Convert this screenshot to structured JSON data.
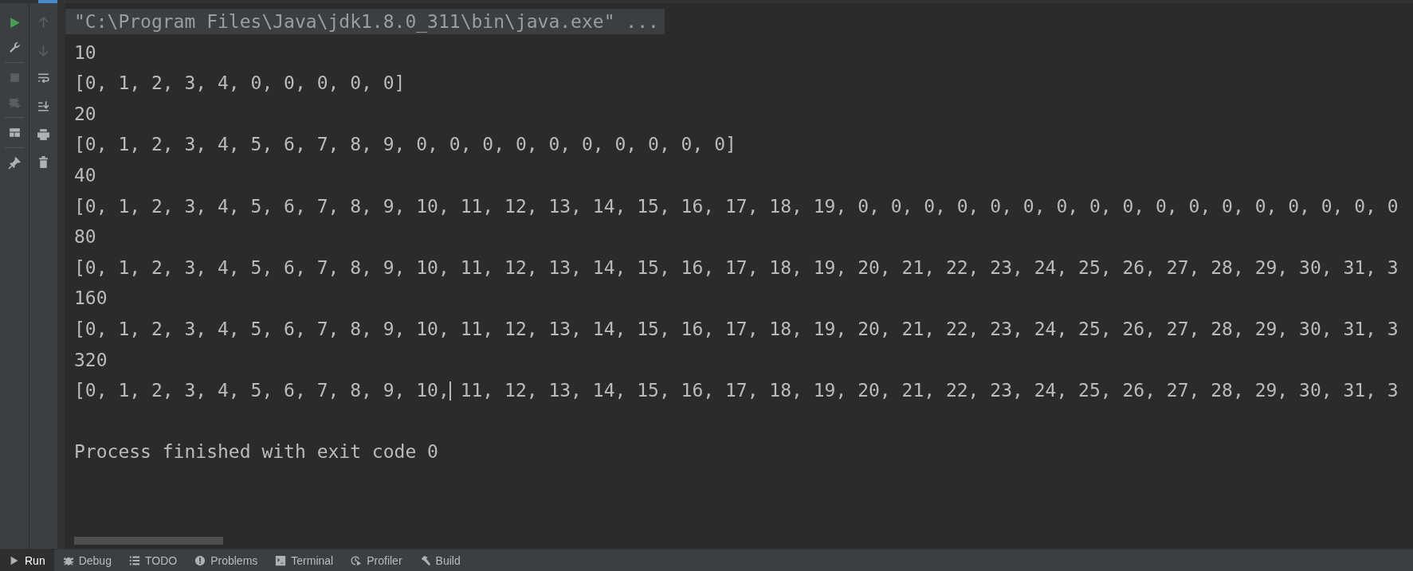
{
  "left_toolbar": [
    {
      "kind": "run",
      "disabled": false
    },
    {
      "kind": "wrench",
      "disabled": false
    },
    {
      "kind": "separator"
    },
    {
      "kind": "stop",
      "disabled": true
    },
    {
      "kind": "debug",
      "disabled": true
    },
    {
      "kind": "separator"
    },
    {
      "kind": "layout",
      "disabled": false
    },
    {
      "kind": "separator"
    },
    {
      "kind": "pin",
      "disabled": false
    }
  ],
  "console_toolbar": [
    {
      "kind": "up",
      "disabled": true
    },
    {
      "kind": "down",
      "disabled": true
    },
    {
      "kind": "wrap",
      "disabled": false
    },
    {
      "kind": "scrollend",
      "disabled": false
    },
    {
      "kind": "print",
      "disabled": false
    },
    {
      "kind": "trash",
      "disabled": false
    }
  ],
  "console_lines": [
    {
      "kind": "command",
      "text": "\"C:\\Program Files\\Java\\jdk1.8.0_311\\bin\\java.exe\" ..."
    },
    {
      "kind": "output",
      "text": "10"
    },
    {
      "kind": "output",
      "text": "[0, 1, 2, 3, 4, 0, 0, 0, 0, 0]"
    },
    {
      "kind": "output",
      "text": "20"
    },
    {
      "kind": "output",
      "text": "[0, 1, 2, 3, 4, 5, 6, 7, 8, 9, 0, 0, 0, 0, 0, 0, 0, 0, 0, 0]"
    },
    {
      "kind": "output",
      "text": "40"
    },
    {
      "kind": "output",
      "text": "[0, 1, 2, 3, 4, 5, 6, 7, 8, 9, 10, 11, 12, 13, 14, 15, 16, 17, 18, 19, 0, 0, 0, 0, 0, 0, 0, 0, 0, 0, 0, 0, 0, 0, 0, 0, 0"
    },
    {
      "kind": "output",
      "text": "80"
    },
    {
      "kind": "output",
      "text": "[0, 1, 2, 3, 4, 5, 6, 7, 8, 9, 10, 11, 12, 13, 14, 15, 16, 17, 18, 19, 20, 21, 22, 23, 24, 25, 26, 27, 28, 29, 30, 31, 3"
    },
    {
      "kind": "output",
      "text": "160"
    },
    {
      "kind": "output",
      "text": "[0, 1, 2, 3, 4, 5, 6, 7, 8, 9, 10, 11, 12, 13, 14, 15, 16, 17, 18, 19, 20, 21, 22, 23, 24, 25, 26, 27, 28, 29, 30, 31, 3"
    },
    {
      "kind": "output",
      "text": "320"
    },
    {
      "kind": "output",
      "text": "[0, 1, 2, 3, 4, 5, 6, 7, 8, 9, 10, 11, 12, 13, 14, 15, 16, 17, 18, 19, 20, 21, 22, 23, 24, 25, 26, 27, 28, 29, 30, 31, 3",
      "caret": true
    },
    {
      "kind": "blank"
    },
    {
      "kind": "output",
      "text": "Process finished with exit code 0"
    }
  ],
  "bottom_tabs": [
    {
      "kind": "run",
      "label": "Run",
      "selected": true
    },
    {
      "kind": "debug",
      "label": "Debug",
      "selected": false
    },
    {
      "kind": "todo",
      "label": "TODO",
      "selected": false
    },
    {
      "kind": "problems",
      "label": "Problems",
      "selected": false
    },
    {
      "kind": "terminal",
      "label": "Terminal",
      "selected": false
    },
    {
      "kind": "profiler",
      "label": "Profiler",
      "selected": false
    },
    {
      "kind": "build",
      "label": "Build",
      "selected": false
    }
  ]
}
